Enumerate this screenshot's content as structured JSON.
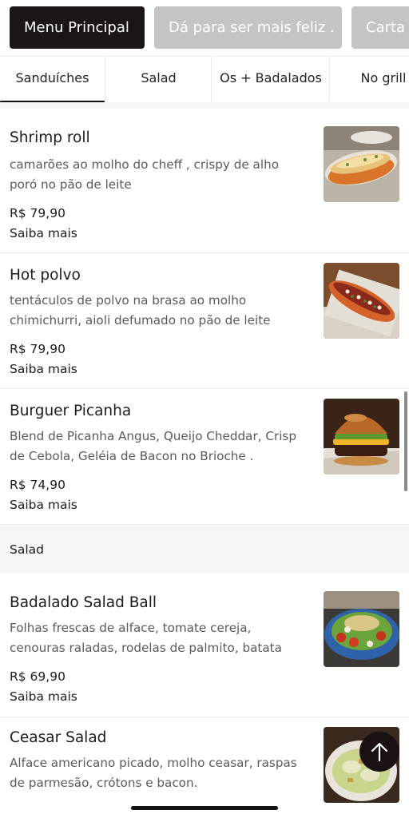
{
  "menu_tabs": [
    {
      "label": "Menu Principal",
      "active": true
    },
    {
      "label": "Dá para ser mais feliz .",
      "active": false
    },
    {
      "label": "Carta de",
      "active": false
    }
  ],
  "category_tabs": [
    {
      "label": "Sanduíches",
      "active": true
    },
    {
      "label": "Salad",
      "active": false
    },
    {
      "label": "Os + Badalados",
      "active": false
    },
    {
      "label": "No grill",
      "active": false
    }
  ],
  "items": [
    {
      "name": "Shrimp roll",
      "description": "camarões ao molho do cheff , crispy de alho poró no pão de leite",
      "price": "R$ 79,90",
      "more": "Saiba mais",
      "image": "shrimp-roll-photo"
    },
    {
      "name": "Hot polvo",
      "description": "tentáculos de polvo na brasa ao molho chimichurri, aioli defumado no pão de leite",
      "price": "R$ 79,90",
      "more": "Saiba mais",
      "image": "hot-polvo-photo"
    },
    {
      "name": "Burguer Picanha",
      "description": "Blend de Picanha Angus, Queijo Cheddar, Crisp de Cebola, Geléia de Bacon no Brioche .",
      "price": "R$ 74,90",
      "more": "Saiba mais",
      "image": "burger-photo"
    }
  ],
  "salad_section": {
    "title": "Salad",
    "items": [
      {
        "name": "Badalado Salad Ball",
        "description": "Folhas frescas de alface, tomate cereja, cenouras raladas, rodelas de palmito, batata palha caseir...",
        "price": "R$ 69,90",
        "more": "Saiba mais",
        "image": "salad-ball-photo"
      },
      {
        "name": "Ceasar Salad",
        "description": "Alface americano picado, molho ceasar, raspas de parmesão, crótons e bacon.",
        "image": "ceasar-salad-photo"
      }
    ]
  },
  "icons": {
    "back_to_top": "arrow-up-icon"
  },
  "colors": {
    "active_pill": "#1c1515",
    "inactive_pill": "#c4c4c4",
    "section_bg": "#f6f6f6"
  }
}
